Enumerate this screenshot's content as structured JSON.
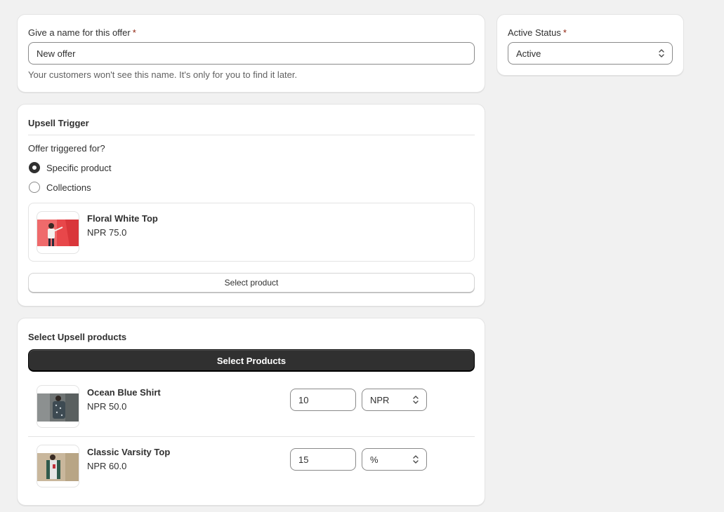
{
  "offer_name": {
    "label": "Give a name for this offer",
    "required_mark": "*",
    "value": "New offer",
    "help": "Your customers won't see this name. It's only for you to find it later."
  },
  "status": {
    "label": "Active Status",
    "required_mark": "*",
    "value": "Active"
  },
  "trigger": {
    "title": "Upsell Trigger",
    "question": "Offer triggered for?",
    "options": [
      {
        "label": "Specific product",
        "checked": true
      },
      {
        "label": "Collections",
        "checked": false
      }
    ],
    "product": {
      "name": "Floral White Top",
      "price": "NPR 75.0",
      "image": "floral-white-top-image"
    },
    "select_button": "Select product"
  },
  "upsell": {
    "title": "Select Upsell products",
    "select_button": "Select Products",
    "products": [
      {
        "name": "Ocean Blue Shirt",
        "price": "NPR 50.0",
        "discount": "10",
        "unit": "NPR",
        "image": "ocean-blue-shirt-image"
      },
      {
        "name": "Classic Varsity Top",
        "price": "NPR 60.0",
        "discount": "15",
        "unit": "%",
        "image": "classic-varsity-top-image"
      }
    ]
  },
  "colors": {
    "background": "#f1f1f1",
    "card": "#ffffff",
    "primary_button": "#303030",
    "required": "#8e1f0b",
    "help_text": "#616161"
  }
}
